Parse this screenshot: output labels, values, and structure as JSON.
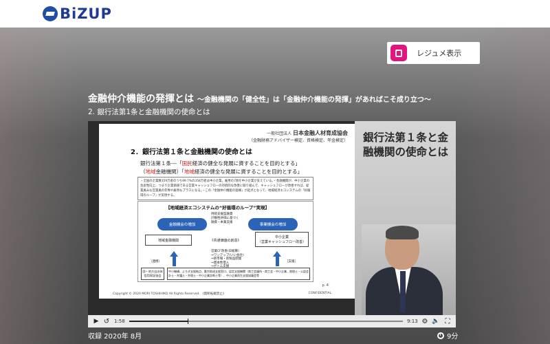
{
  "header": {
    "logo_text": "BiZUP"
  },
  "resume_button": {
    "label": "レジュメ表示",
    "icon": "note-icon",
    "icon_color": "#e3147d"
  },
  "course": {
    "title_main": "金融仲介機能の発揮とは",
    "title_sub": "〜金融機関の「健全性」は「金融仲介機能の発揮」があればこそ成り立つ〜",
    "lesson": "2. 銀行法第1条と金融機関の使命とは"
  },
  "slide": {
    "association_line1": "一般社団法人",
    "association_name": "日本金融人材育成協会",
    "association_line2": "（金融財務アドバイザー検定、資格検定、年金検定）",
    "heading": "2．銀行法第１条と金融機関の使命とは",
    "line1_prefix": "銀行法第１条---「",
    "line1_red": "国民",
    "line1_suffix": "経済の健全な発展に資することを目的とする」",
    "line2_prefix": "（",
    "line2_red_a": "地域",
    "line2_mid": "金融機関）「",
    "line2_red_b": "地域",
    "line2_suffix": "経済の健全な発展に資することを目的とする」",
    "box_text": "・全国の企業数359万者のうち99.7%の358万者は中小企業。雇用の7割を中小企業が支えている。・金融機関が、中小企業の生産性向上、つまり企業価値である営業キャッシュフローの持続的な改善に取り組んで、キャッシュフローが改善すれば、従業員みな営業員の年俸や雇用もプラスになる。・この「金融仲介機能の発揮」が起点となって、地域経済エコシステムの「好循環のループ」が実現する。",
    "eco_title": "【地域経済エコシステムの“好循環のループ”実現】",
    "pill_left": "金融機会の増加",
    "pill_right": "事業機会の増加",
    "center_note": "持続支援型融資\n計数性評価に基づく\n融資・本業支援",
    "box_regional_bank": "地域金融機関",
    "box_shared_value": "《共通価値の創造》",
    "box_sme": "中小企業\n（営業キャッシュフロー改善）",
    "support_note": "営業CF改善(日総算)\n⇒ワンアップ(いい会社)\n⇒新市場・新製品開発\n⇒資本性借入\n⇒ボトム支援",
    "label_enhance": "（連携）",
    "label_support": "［支援］",
    "left_bottom": "国・地方自治体\n信用保証協会",
    "bottom_text": "中小機構、よろず支援拠点、勤労助成支援窓口、認定支援機関（商工会議所・商工会・中小企業、税理士・公認会計士・弁護士・弁理士・中小企業診断士等）、中小企業再生支援協議会等",
    "copyright": "Copyright © 2020   MORI TOSHIHIKO   All Rights Reserved.    《無断転載禁止》",
    "page": "p. 4",
    "confidential": "CONFIDENTIAL"
  },
  "side_panel": {
    "title": "銀行法第１条と金融機関の使命とは"
  },
  "player": {
    "current_time": "1:58",
    "duration": "9:13",
    "progress_fraction": 0.213
  },
  "footer": {
    "recorded": "収録 2020年 8月",
    "length": "9分"
  }
}
